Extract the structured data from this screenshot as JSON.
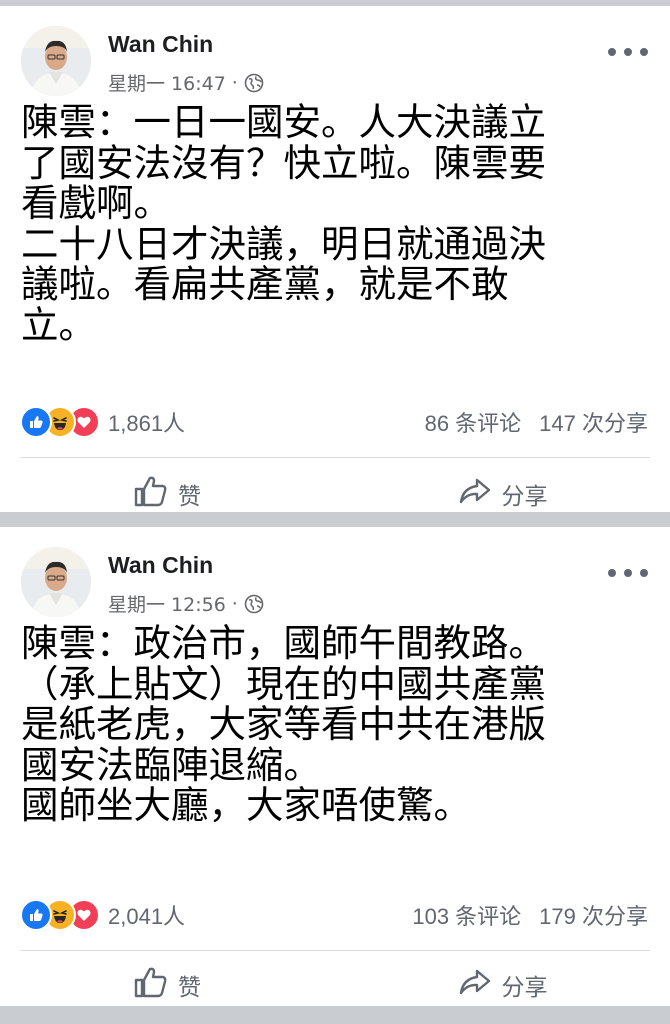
{
  "posts": [
    {
      "author": "Wan Chin",
      "time": "星期一 16:47",
      "separator": "·",
      "lines": [
        "陳雲：一日一國安。人大決議立",
        "了國安法沒有？快立啦。陳雲要",
        "看戲啊。",
        "二十八日才決議，明日就通過決",
        "議啦。看扁共產黨，就是不敢",
        "立。"
      ],
      "reaction_count": "1,861人",
      "comments": "86 条评论",
      "shares": "147 次分享",
      "like_label": "赞",
      "share_label": "分享"
    },
    {
      "author": "Wan Chin",
      "time": "星期一 12:56",
      "separator": "·",
      "lines": [
        "陳雲：政治市，國師午間教路。",
        "（承上貼文）現在的中國共產黨",
        "是紙老虎，大家等看中共在港版",
        "國安法臨陣退縮。",
        "國師坐大廳，大家唔使驚。"
      ],
      "reaction_count": "2,041人",
      "comments": "103 条评论",
      "shares": "179 次分享",
      "like_label": "赞",
      "share_label": "分享"
    }
  ],
  "icons": {
    "globe": "globe-icon",
    "more": "more-options-icon",
    "like": "thumbs-up-icon",
    "share": "share-arrow-icon",
    "reactions": [
      "like-reaction-icon",
      "haha-reaction-icon",
      "love-reaction-icon"
    ]
  },
  "colors": {
    "like_blue": "#1877f2",
    "haha_yellow": "#f7b125",
    "love_red": "#f33e58",
    "secondary_text": "#65676b"
  }
}
